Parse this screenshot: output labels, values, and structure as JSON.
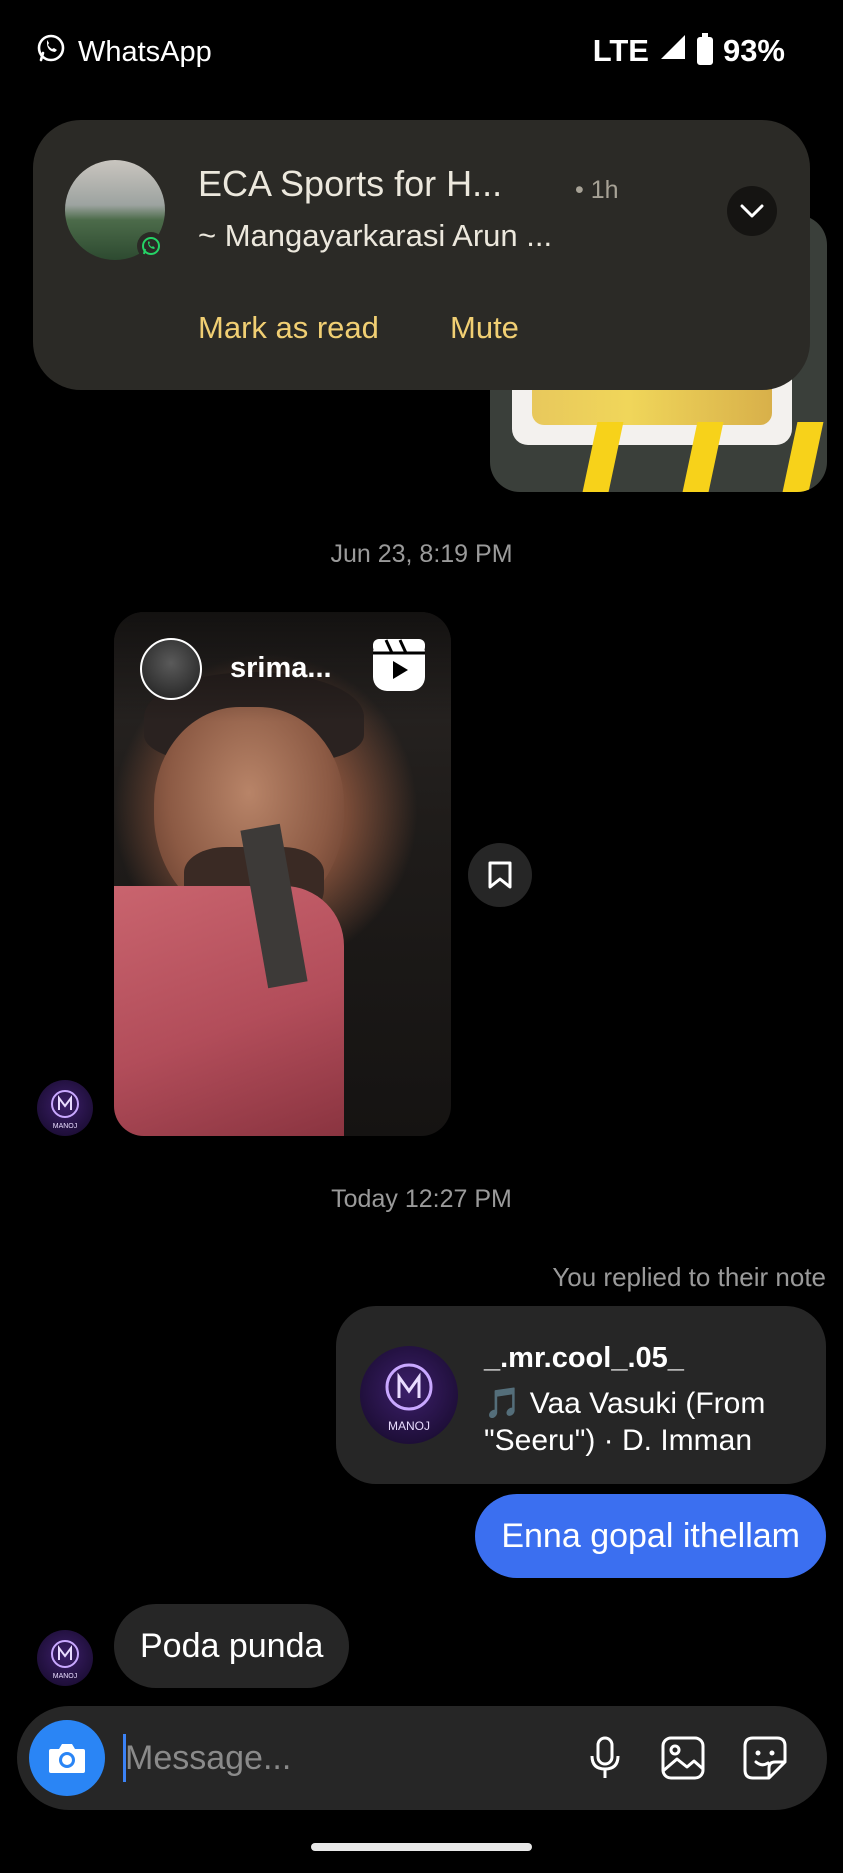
{
  "status_bar": {
    "app_name": "WhatsApp",
    "network": "LTE",
    "battery": "93%"
  },
  "notification": {
    "title": "ECA Sports for H...",
    "time": "• 1h",
    "subtitle": "~ Mangayarkarasi Arun ...",
    "actions": {
      "mark_as_read": "Mark as read",
      "mute": "Mute"
    },
    "accent_color": "#f1cf73"
  },
  "chat": {
    "timestamp_1": "Jun 23, 8:19 PM",
    "reel": {
      "username": "srima..."
    },
    "timestamp_2": "Today 12:27 PM",
    "reply_caption": "You replied to their note",
    "note": {
      "username": "_.mr.cool_.05_",
      "song_line_1": "🎵 Vaa Vasuki (From",
      "song_line_2": "\"Seeru\") · D. Imman",
      "avatar_text": "MANOJ"
    },
    "sent_message": "Enna gopal ithellam",
    "received_message": "Poda punda",
    "avatar_text": "MANOJ"
  },
  "composer": {
    "placeholder": "Message..."
  },
  "colors": {
    "sent_bubble": "#3b6ff0",
    "camera_button": "#2a85f5"
  }
}
